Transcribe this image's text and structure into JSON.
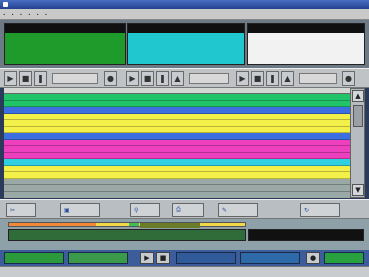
{
  "colors": {
    "deck1": "#1e9b2a",
    "deck2": "#21c7cf",
    "deck3": "#f2f2f2",
    "row_green": "#22c46a",
    "row_yellow": "#f4f04a",
    "row_magenta": "#ee3fbf",
    "row_blue": "#3d6fe0",
    "row_cyan": "#2fd0e0"
  },
  "titlebar": {
    "icon": "app-icon"
  },
  "menubar": {
    "items": [
      "•",
      "•",
      "•",
      "•",
      "•",
      "•"
    ]
  },
  "decks": [
    {
      "icon": "deck-icon"
    },
    {
      "icon": "deck-icon"
    },
    {
      "icon": "deck-icon"
    }
  ],
  "transport": {
    "icons": [
      "play-icon",
      "stop-icon",
      "pause-icon",
      "eject-icon",
      "next-icon"
    ]
  },
  "playlist": {
    "rows": [
      {
        "color": "#22c46a"
      },
      {
        "color": "#22c46a"
      },
      {
        "color": "#3d6fe0"
      },
      {
        "color": "#f4f04a"
      },
      {
        "color": "#f4f04a"
      },
      {
        "color": "#f4f04a"
      },
      {
        "color": "#3d6fe0"
      },
      {
        "color": "#ee3fbf"
      },
      {
        "color": "#ee3fbf"
      },
      {
        "color": "#ee3fbf"
      },
      {
        "color": "#2fd0e0"
      },
      {
        "color": "#f4f04a"
      },
      {
        "color": "#f4f04a"
      },
      {
        "color": "#9aa9a6"
      },
      {
        "color": "#9aa9a6"
      }
    ]
  },
  "functions": {
    "icons": [
      "cut-icon",
      "insert-icon",
      "find-icon",
      "print-icon",
      "edit-icon",
      "refresh-icon"
    ]
  },
  "progress": {
    "value": 0.37
  }
}
